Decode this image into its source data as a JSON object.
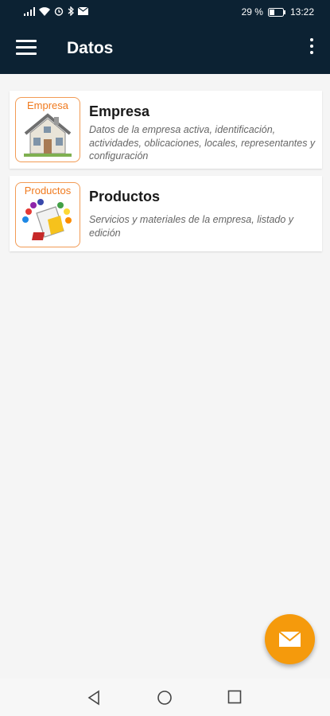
{
  "status_bar": {
    "battery_percent": "29 %",
    "time": "13:22",
    "icons": [
      "signal-icon",
      "wifi-icon",
      "alarm-icon",
      "bluetooth-icon",
      "mail-icon",
      "battery-icon"
    ]
  },
  "toolbar": {
    "title": "Datos",
    "menu_icon": "hamburger-icon",
    "more_icon": "more-vert-icon",
    "background": "#0c2233"
  },
  "items": [
    {
      "thumb_label": "Empresa",
      "title": "Empresa",
      "description": "Datos de la empresa activa, identificación, actividades, oblicaciones, locales, representantes y configuración",
      "icon": "house-icon"
    },
    {
      "thumb_label": "Productos",
      "title": "Productos",
      "description": "Servicios y materiales de la empresa, listado y edición",
      "icon": "paint-bucket-icon"
    }
  ],
  "fab": {
    "icon": "envelope-icon",
    "color": "#f59a0c"
  },
  "accent": "#f07a1e"
}
